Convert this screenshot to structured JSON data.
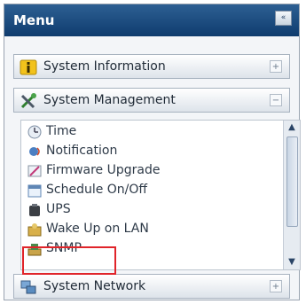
{
  "menu": {
    "title": "Menu",
    "collapse_icon": "collapse-icon"
  },
  "sections": {
    "system_information": {
      "label": "System Information",
      "icon": "info-icon",
      "toggle": "+"
    },
    "system_management": {
      "label": "System Management",
      "icon": "tools-icon",
      "toggle": "−"
    },
    "system_network": {
      "label": "System Network",
      "icon": "network-icon",
      "toggle": "+"
    }
  },
  "management_items": [
    {
      "label": "Time",
      "icon": "clock-icon"
    },
    {
      "label": "Notification",
      "icon": "notification-icon"
    },
    {
      "label": "Firmware Upgrade",
      "icon": "firmware-icon"
    },
    {
      "label": "Schedule On/Off",
      "icon": "schedule-icon"
    },
    {
      "label": "UPS",
      "icon": "ups-icon"
    },
    {
      "label": "Wake Up on LAN",
      "icon": "wake-on-lan-icon"
    },
    {
      "label": "SNMP",
      "icon": "snmp-icon"
    }
  ],
  "colors": {
    "header": "#0f3c6e",
    "highlight": "#e0242a"
  }
}
